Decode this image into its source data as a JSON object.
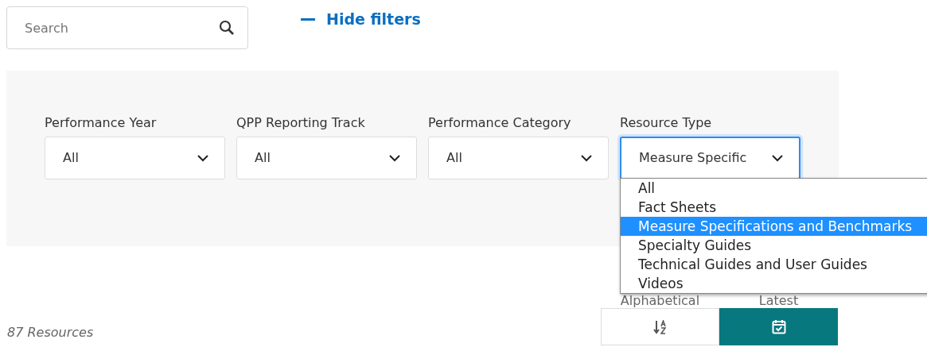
{
  "search": {
    "placeholder": "Search"
  },
  "filter_toggle": {
    "label": "Hide filters",
    "expanded": true
  },
  "filters": [
    {
      "label": "Performance Year",
      "value": "All",
      "open": false
    },
    {
      "label": "QPP Reporting Track",
      "value": "All",
      "open": false
    },
    {
      "label": "Performance Category",
      "value": "All",
      "open": false
    },
    {
      "label": "Resource Type",
      "value": "Measure Specific",
      "open": true
    }
  ],
  "dropdown_options": [
    {
      "label": "All",
      "selected": false
    },
    {
      "label": "Fact Sheets",
      "selected": false
    },
    {
      "label": "Measure Specifications and Benchmarks",
      "selected": true
    },
    {
      "label": "Specialty Guides",
      "selected": false
    },
    {
      "label": "Technical Guides and User Guides",
      "selected": false
    },
    {
      "label": "Videos",
      "selected": false
    }
  ],
  "results_count": "87 Resources",
  "sort_options": [
    {
      "label": "Alphabetical",
      "kind": "alpha",
      "selected": false
    },
    {
      "label": "Latest",
      "kind": "date",
      "selected": true
    }
  ]
}
